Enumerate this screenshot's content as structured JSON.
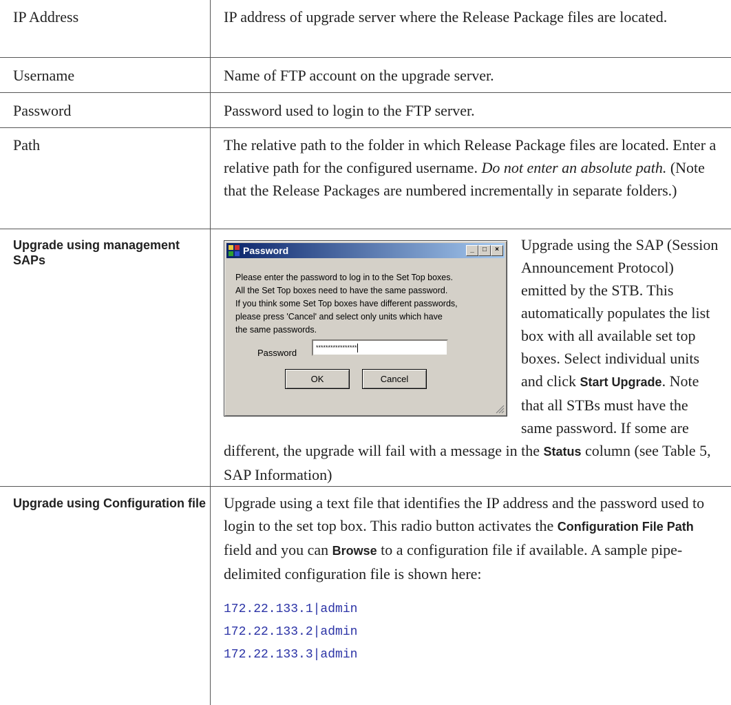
{
  "rows": [
    {
      "label": "IP Address",
      "desc": "IP address of upgrade server where the Release Package files are located."
    },
    {
      "label": "Username",
      "desc": "Name of FTP account on the upgrade server."
    },
    {
      "label": "Password",
      "desc": "Password used to login to the FTP server."
    },
    {
      "label": "Path",
      "desc_a": "The relative path to the folder in which Release Package files are located. Enter a relative path for the configured username. ",
      "desc_em": "Do not enter an absolute path.",
      "desc_b": " (Note that the Release Packages are numbered incrementally in separate folders.)"
    }
  ],
  "saps": {
    "label": "Upgrade using management SAPs",
    "t1": "Upgrade using the SAP (Session Announcement Protocol) emitted by the STB. This automatically populates the list box with all available set top boxes. Select individual units and click ",
    "b1": "Start Upgrade",
    "t2": ". Note that all STBs must have the same password. If some are different, the upgrade will fail with a message in the ",
    "b2": "Status",
    "t3": " column (see Table 5,  SAP Information)"
  },
  "dialog": {
    "title": "Password",
    "message_lines": [
      "Please enter the password to log in to the Set Top boxes.",
      "All the Set Top boxes need to have the  same password.",
      "If you think some Set Top boxes have different passwords,",
      "please press 'Cancel' and select only units which have",
      "the same passwords."
    ],
    "password_label": "Password",
    "password_value": "*****************",
    "ok_label": "OK",
    "cancel_label": "Cancel"
  },
  "config": {
    "label": "Upgrade using Configuration file",
    "t1": "Upgrade using a text file that identifies the IP address and the password used to login to the set top box. This radio button activates the ",
    "b1": "Configuration File Path",
    "t2": " field and you can ",
    "b2": "Browse",
    "t3": " to a configuration file if available. A sample pipe-delimited configuration file is shown here:",
    "code_lines": [
      "172.22.133.1|admin",
      "172.22.133.2|admin",
      "172.22.133.3|admin"
    ]
  }
}
